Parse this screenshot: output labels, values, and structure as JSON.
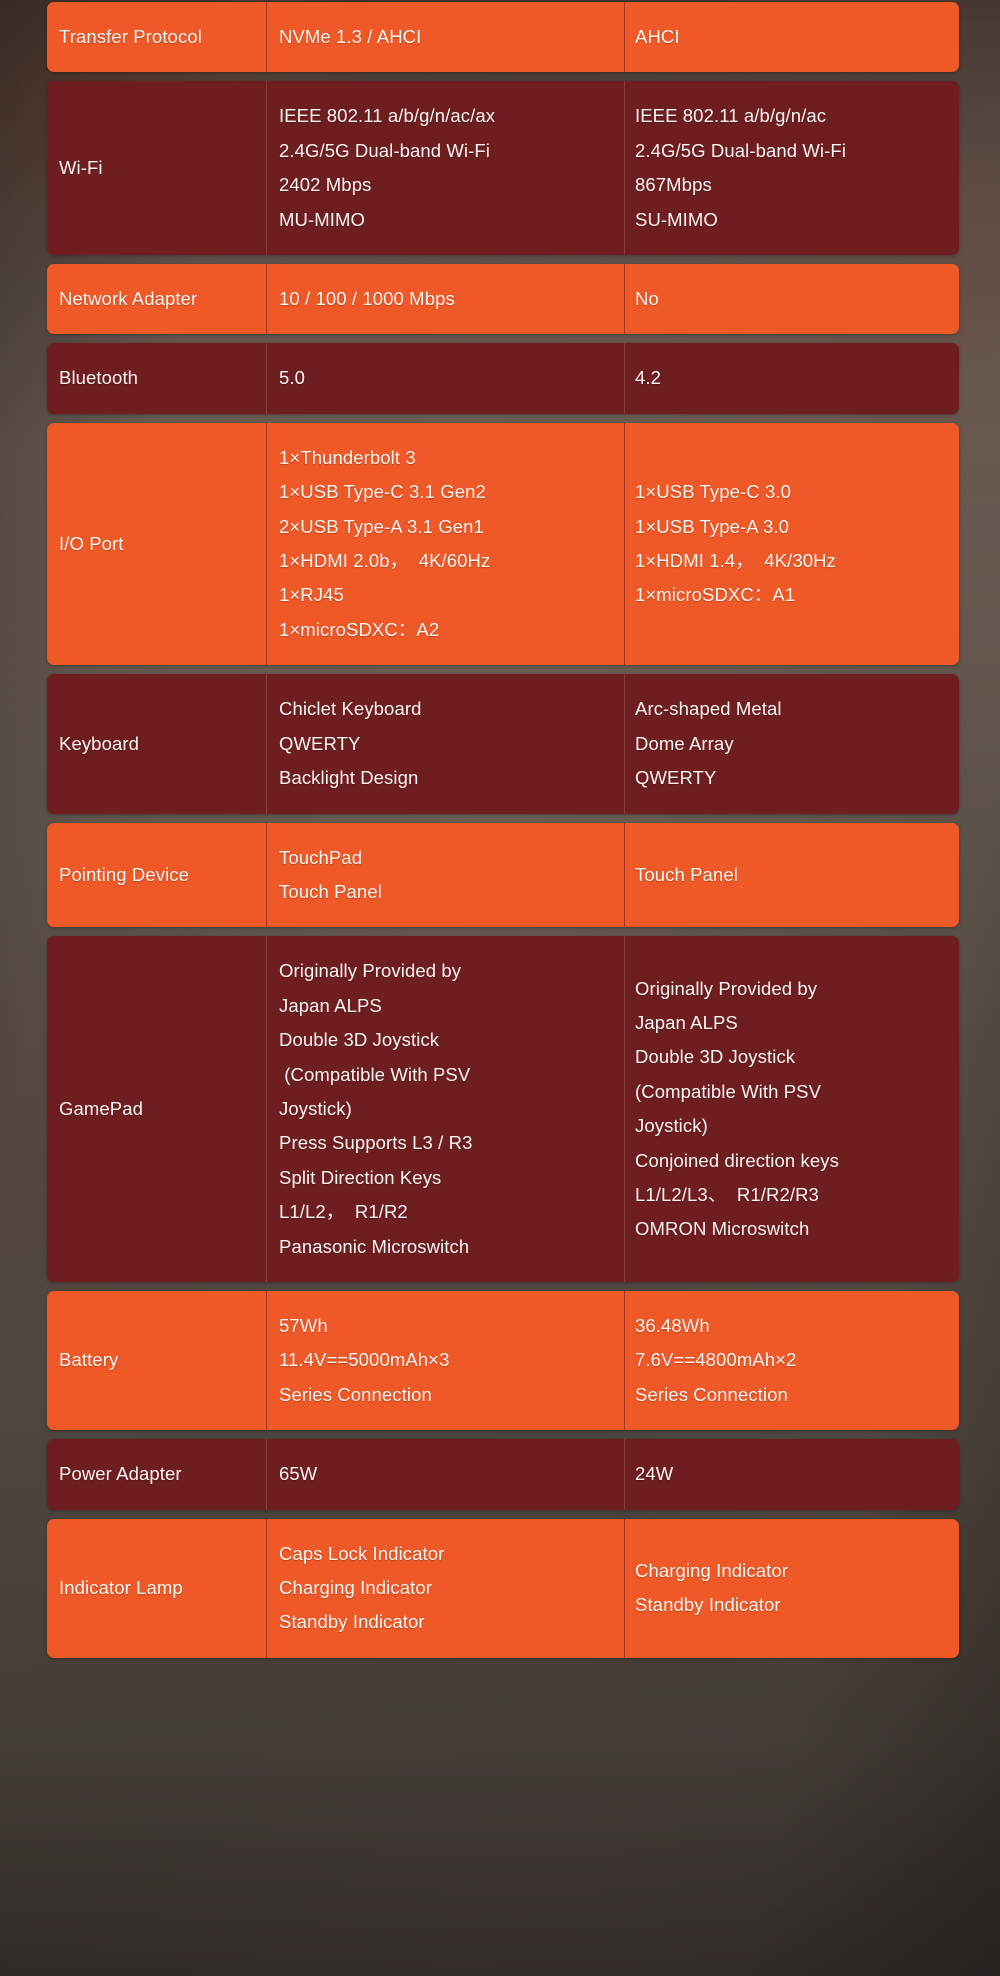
{
  "table": {
    "rows": [
      {
        "id": "transfer-protocol",
        "style": "orange",
        "label": "Transfer Protocol",
        "col_a": [
          "NVMe 1.3 / AHCI"
        ],
        "col_b": [
          "AHCI"
        ]
      },
      {
        "id": "wifi",
        "style": "dark",
        "label": "Wi-Fi",
        "col_a": [
          "IEEE 802.11 a/b/g/n/ac/ax",
          "2.4G/5G Dual-band Wi-Fi",
          "2402 Mbps",
          "MU-MIMO"
        ],
        "col_b": [
          "IEEE 802.11 a/b/g/n/ac",
          "2.4G/5G Dual-band Wi-Fi",
          "867Mbps",
          "SU-MIMO"
        ]
      },
      {
        "id": "network-adapter",
        "style": "orange",
        "label": "Network Adapter",
        "col_a": [
          "10 / 100 / 1000 Mbps"
        ],
        "col_b": [
          "No"
        ]
      },
      {
        "id": "bluetooth",
        "style": "dark",
        "label": "Bluetooth",
        "col_a": [
          "5.0"
        ],
        "col_b": [
          "4.2"
        ]
      },
      {
        "id": "io-port",
        "style": "orange",
        "label": "I/O Port",
        "col_a": [
          "1×Thunderbolt 3",
          "1×USB Type-C 3.1 Gen2",
          "2×USB Type-A 3.1 Gen1",
          "1×HDMI 2.0b，  4K/60Hz",
          "1×RJ45",
          "1×microSDXC：A2"
        ],
        "col_b": [
          "1×USB Type-C 3.0",
          "1×USB Type-A 3.0",
          "1×HDMI 1.4，  4K/30Hz",
          "1×microSDXC：A1"
        ]
      },
      {
        "id": "keyboard",
        "style": "dark",
        "label": "Keyboard",
        "col_a": [
          "Chiclet Keyboard",
          "QWERTY",
          "Backlight Design"
        ],
        "col_b": [
          "Arc-shaped Metal",
          "Dome Array",
          "QWERTY"
        ]
      },
      {
        "id": "pointing-device",
        "style": "orange",
        "label": "Pointing Device",
        "col_a": [
          "TouchPad",
          "Touch Panel"
        ],
        "col_b": [
          "Touch Panel"
        ]
      },
      {
        "id": "gamepad",
        "style": "dark",
        "label": "GamePad",
        "col_a": [
          "Originally Provided by",
          "Japan ALPS",
          "Double 3D Joystick",
          " (Compatible With PSV",
          "Joystick)",
          "Press Supports L3 / R3",
          "Split Direction Keys",
          "L1/L2，  R1/R2",
          "Panasonic Microswitch"
        ],
        "col_b": [
          "Originally Provided by",
          "Japan ALPS",
          "Double 3D Joystick",
          "(Compatible With PSV",
          "Joystick)",
          "Conjoined direction keys",
          "L1/L2/L3、  R1/R2/R3",
          "OMRON Microswitch"
        ]
      },
      {
        "id": "battery",
        "style": "orange",
        "label": "Battery",
        "col_a": [
          "57Wh",
          "11.4V==5000mAh×3",
          "Series Connection"
        ],
        "col_b": [
          "36.48Wh",
          "7.6V==4800mAh×2",
          "Series Connection"
        ]
      },
      {
        "id": "power-adapter",
        "style": "dark",
        "label": "Power Adapter",
        "col_a": [
          "65W"
        ],
        "col_b": [
          "24W"
        ]
      },
      {
        "id": "indicator-lamp",
        "style": "orange",
        "label": "Indicator Lamp",
        "col_a": [
          "Caps Lock Indicator",
          "Charging Indicator",
          "Standby Indicator"
        ],
        "col_b": [
          "Charging Indicator",
          "Standby Indicator"
        ]
      }
    ]
  },
  "colors": {
    "row_orange": "#ef5827",
    "row_dark": "#6e1e21",
    "text": "#fdf6f1",
    "backdrop": "#5c5149"
  }
}
